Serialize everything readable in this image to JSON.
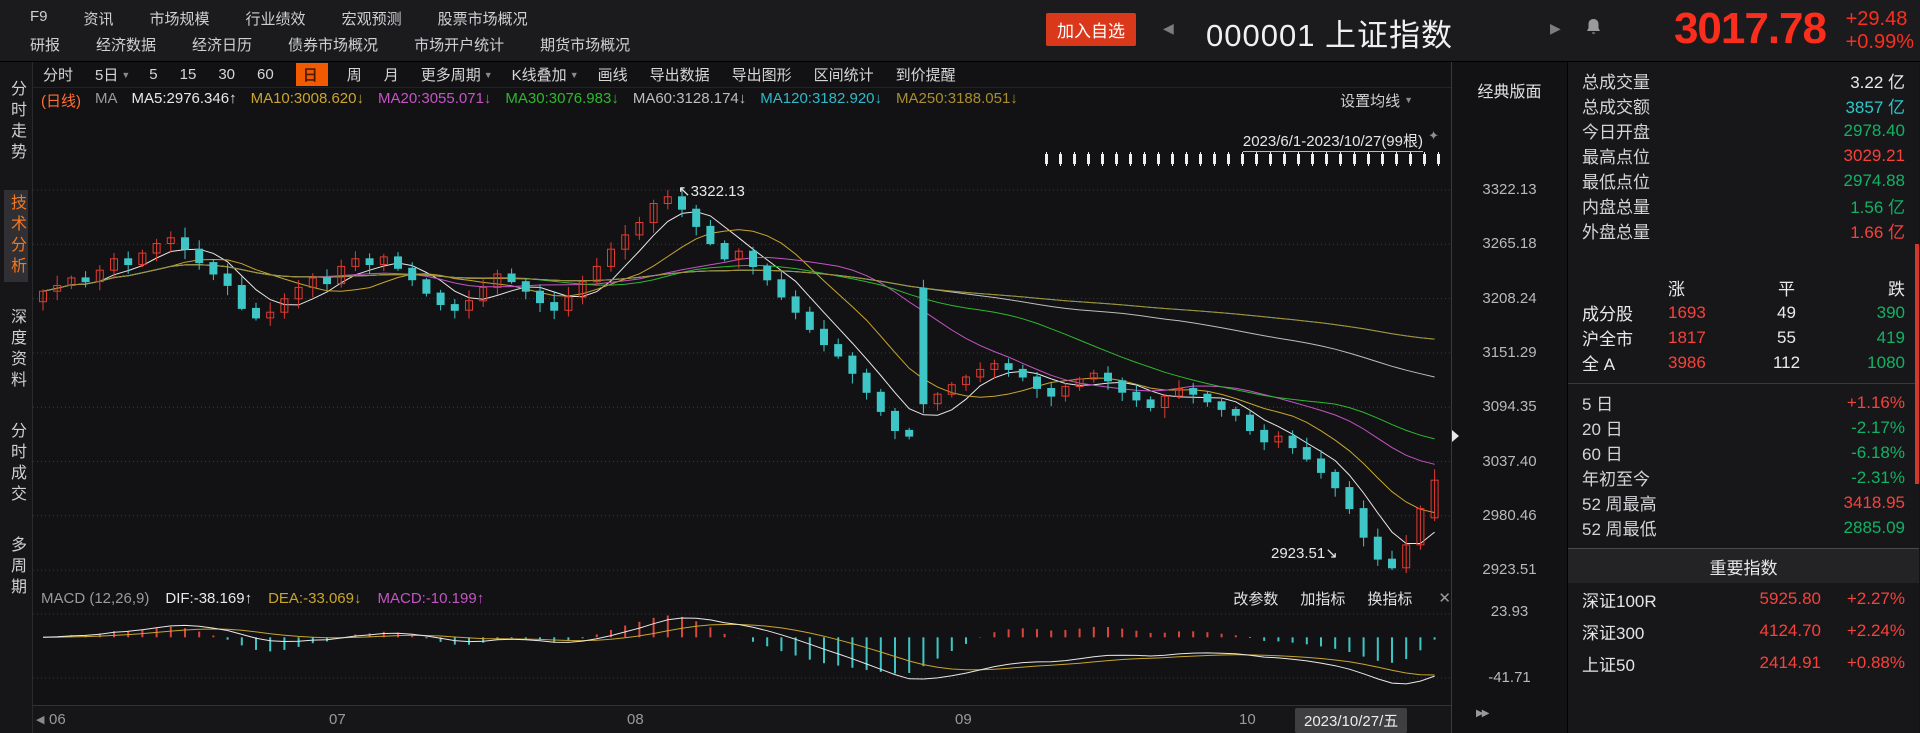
{
  "header": {
    "menu_row1": [
      {
        "label": "F9"
      },
      {
        "label": "资讯"
      },
      {
        "label": "市场规模"
      },
      {
        "label": "行业绩效"
      },
      {
        "label": "宏观预测"
      },
      {
        "label": "股票市场概况"
      }
    ],
    "menu_row2": [
      {
        "label": "研报"
      },
      {
        "label": "经济数据"
      },
      {
        "label": "经济日历"
      },
      {
        "label": "债券市场概况"
      },
      {
        "label": "市场开户统计"
      },
      {
        "label": "期货市场概况"
      }
    ],
    "add_watchlist": "加入自选",
    "prev_arrow": "◀",
    "next_arrow": "▶",
    "title": "000001 上证指数",
    "price": "3017.78",
    "change": "+29.48",
    "change_pct": "+0.99%"
  },
  "sidebar": {
    "items": [
      {
        "label": "分时走势"
      },
      {
        "label": "技术分析",
        "active": true
      },
      {
        "label": "深度资料"
      },
      {
        "label": "分时成交"
      },
      {
        "label": "多周期"
      }
    ]
  },
  "toolbar": {
    "items": [
      {
        "label": "分时"
      },
      {
        "label": "5日",
        "caret": "▼"
      },
      {
        "label": "5"
      },
      {
        "label": "15"
      },
      {
        "label": "30"
      },
      {
        "label": "60"
      },
      {
        "label": "日",
        "active": true
      },
      {
        "label": "周"
      },
      {
        "label": "月"
      },
      {
        "label": "更多周期",
        "caret": "▼"
      },
      {
        "label": "K线叠加",
        "caret": "▼"
      },
      {
        "label": "画线"
      },
      {
        "label": "导出数据"
      },
      {
        "label": "导出图形"
      },
      {
        "label": "区间统计"
      },
      {
        "label": "到价提醒"
      }
    ],
    "classic_layout": "经典版面"
  },
  "ma_legend": {
    "items": [
      {
        "text": "(日线)",
        "cls": "ma-src"
      },
      {
        "text": "MA",
        "cls": "ma-t"
      },
      {
        "text": "MA5:2976.346↑",
        "cls": "ma5"
      },
      {
        "text": "MA10:3008.620↓",
        "cls": "ma10"
      },
      {
        "text": "MA20:3055.071↓",
        "cls": "ma20"
      },
      {
        "text": "MA30:3076.983↓",
        "cls": "ma30"
      },
      {
        "text": "MA60:3128.174↓",
        "cls": "ma60"
      },
      {
        "text": "MA120:3182.920↓",
        "cls": "ma120"
      },
      {
        "text": "MA250:3188.051↓",
        "cls": "ma250"
      }
    ],
    "settings": "设置均线",
    "caret": "▼"
  },
  "chart_area": {
    "range_label": "2023/6/1-2023/10/27(99根)",
    "pin": "✦",
    "high_annotation": "↖3322.13",
    "low_annotation": "2923.51↘"
  },
  "macd": {
    "title": "MACD (12,26,9)",
    "dif": "DIF:-38.169↑",
    "dea": "DEA:-33.069↓",
    "macd": "MACD:-10.199↑",
    "buttons": [
      {
        "label": "改参数"
      },
      {
        "label": "加指标"
      },
      {
        "label": "换指标"
      }
    ],
    "close": "✕",
    "labels": {
      "top": "23.93",
      "bottom": "-41.71"
    }
  },
  "xaxis": {
    "left_arrow": "◀",
    "months": [
      {
        "m": "06"
      },
      {
        "m": "07"
      },
      {
        "m": "08"
      },
      {
        "m": "09"
      },
      {
        "m": "10"
      }
    ],
    "date": "2023/10/27/五",
    "right_arrow": "▶▶"
  },
  "right_panel": {
    "rows1": [
      {
        "label": "总成交量",
        "value": "3.22 亿",
        "color": "white"
      },
      {
        "label": "总成交额",
        "value": "3857 亿",
        "color": "cyan"
      },
      {
        "label": "今日开盘",
        "value": "2978.40",
        "color": "green"
      },
      {
        "label": "最高点位",
        "value": "3029.21",
        "color": "red"
      },
      {
        "label": "最低点位",
        "value": "2974.88",
        "color": "green"
      },
      {
        "label": "内盘总量",
        "value": "1.56 亿",
        "color": "green"
      },
      {
        "label": "外盘总量",
        "value": "1.66 亿",
        "color": "red"
      }
    ],
    "updown_header": {
      "up": "涨",
      "flat": "平",
      "down": "跌"
    },
    "updown_rows": [
      {
        "name": "成分股",
        "up": "1693",
        "flat": "49",
        "down": "390"
      },
      {
        "name": "沪全市",
        "up": "1817",
        "flat": "55",
        "down": "419"
      },
      {
        "name": "全 A",
        "up": "3986",
        "flat": "112",
        "down": "1080"
      }
    ],
    "period_rows": [
      {
        "label": "5 日",
        "value": "+1.16%",
        "color": "red"
      },
      {
        "label": "20 日",
        "value": "-2.17%",
        "color": "green"
      },
      {
        "label": "60 日",
        "value": "-6.18%",
        "color": "green"
      },
      {
        "label": "年初至今",
        "value": "-2.31%",
        "color": "green"
      },
      {
        "label": "52 周最高",
        "value": "3418.95",
        "color": "red"
      },
      {
        "label": "52 周最低",
        "value": "2885.09",
        "color": "green"
      }
    ],
    "index_section": {
      "title": "重要指数",
      "rows": [
        {
          "name": "深证100R",
          "value": "5925.80",
          "pct": "+2.27%"
        },
        {
          "name": "深证300",
          "value": "4124.70",
          "pct": "+2.24%"
        },
        {
          "name": "上证50",
          "value": "2414.91",
          "pct": "+0.88%"
        }
      ]
    }
  },
  "colors": {
    "accent_red": "#fb2e1e",
    "value_red": "#f8413a",
    "value_green": "#11b264",
    "value_cyan": "#2cc8c8",
    "highlight_orange": "#f25a02",
    "candle_up": "#e23b31",
    "candle_down": "#3ec6c6"
  },
  "chart_data": {
    "type": "candlestick",
    "title": "上证指数 日线 2023/6/1-2023/10/27",
    "y_axis_labels": [
      3322.13,
      3265.18,
      3208.24,
      3151.29,
      3094.35,
      3037.4,
      2980.46,
      2923.51
    ],
    "x_axis_labels": [
      "06",
      "07",
      "08",
      "09",
      "10"
    ],
    "high_point": 3322.13,
    "low_point": 2923.51,
    "last_close": 3017.78,
    "macd_axis_labels": [
      23.93,
      -41.71
    ],
    "ma_lines": [
      {
        "window": 5,
        "color": "#e8e8e8"
      },
      {
        "window": 10,
        "color": "#c9a52e"
      },
      {
        "window": 20,
        "color": "#c653c6"
      },
      {
        "window": 30,
        "color": "#2eb82e"
      },
      {
        "window": 60,
        "color": "#bdbdbd"
      },
      {
        "window": 120,
        "color": "#2fb9c9"
      },
      {
        "window": 250,
        "color": "#a98e2f"
      }
    ],
    "candles": {
      "first_open": 3205,
      "closes": [
        3216,
        3222,
        3230,
        3226,
        3238,
        3250,
        3244,
        3256,
        3266,
        3272,
        3260,
        3246,
        3234,
        3222,
        3198,
        3188,
        3194,
        3208,
        3220,
        3230,
        3224,
        3242,
        3250,
        3244,
        3252,
        3240,
        3228,
        3214,
        3202,
        3196,
        3206,
        3220,
        3234,
        3226,
        3216,
        3204,
        3196,
        3210,
        3226,
        3242,
        3260,
        3275,
        3288,
        3308,
        3315,
        3302,
        3284,
        3266,
        3250,
        3258,
        3242,
        3228,
        3210,
        3194,
        3176,
        3160,
        3148,
        3130,
        3110,
        3090,
        3070,
        3064,
        3098,
        3108,
        3118,
        3126,
        3134,
        3140,
        3134,
        3126,
        3114,
        3106,
        3116,
        3124,
        3130,
        3122,
        3110,
        3102,
        3094,
        3106,
        3114,
        3108,
        3100,
        3092,
        3086,
        3070,
        3058,
        3064,
        3052,
        3040,
        3026,
        3010,
        2988,
        2958,
        2935,
        2926,
        2950,
        2988,
        3017.78
      ],
      "month_start_indices": [
        0,
        21,
        42,
        65,
        85
      ],
      "overrides": {
        "44": {
          "high": 3322.13
        },
        "62": {
          "open": 3219,
          "high": 3228,
          "low": 3088
        },
        "95": {
          "low": 2923.51
        },
        "98": {
          "open": 2978.4,
          "high": 3029.21,
          "low": 2974.88
        }
      }
    }
  }
}
